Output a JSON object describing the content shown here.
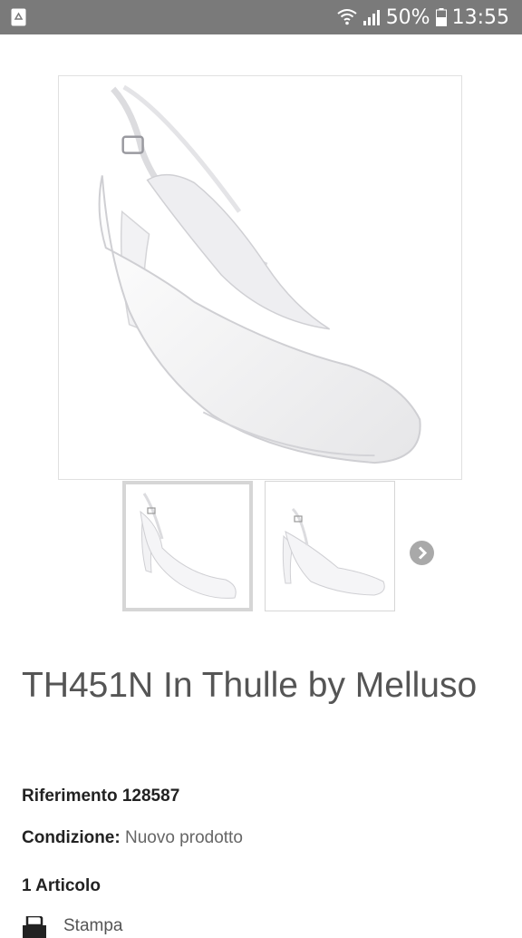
{
  "status_bar": {
    "battery_percent": "50%",
    "time": "13:55",
    "left_icon": "recycle-notification-icon",
    "icons": [
      "wifi-icon",
      "signal-icon",
      "battery-icon"
    ]
  },
  "product": {
    "title": "TH451N In Thulle by Melluso",
    "reference_label": "Riferimento",
    "reference_value": "128587",
    "condition_label": "Condizione:",
    "condition_value": "Nuovo prodotto",
    "quantity_text": "1 Articolo",
    "print_label": "Stampa"
  },
  "gallery": {
    "thumbnails": [
      "thumb-front-view",
      "thumb-side-view"
    ],
    "selected_index": 0,
    "next_icon": "chevron-right-icon"
  },
  "colors": {
    "status_bar": "#7a7a7a",
    "title_text": "#555555",
    "selected_thumb_border": "#d6d6d6"
  }
}
